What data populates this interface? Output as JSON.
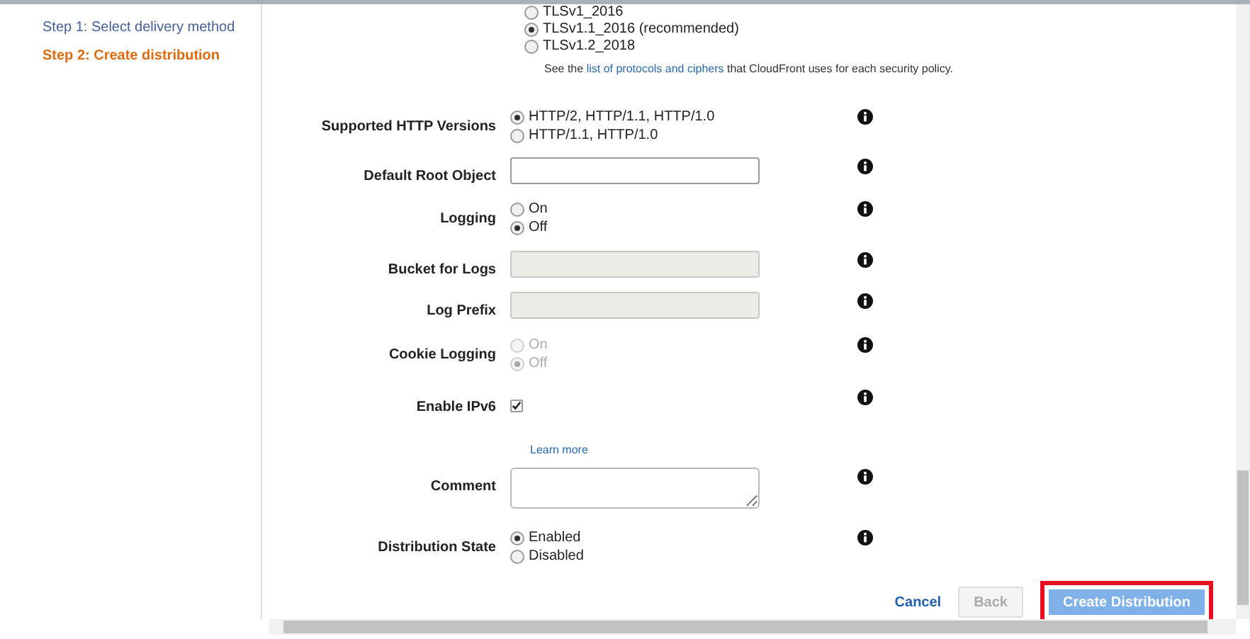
{
  "steps": [
    {
      "label": "Step 1: Select delivery method",
      "selected": false
    },
    {
      "label": "Step 2: Create distribution",
      "selected": true
    }
  ],
  "security_policy": {
    "options": [
      {
        "label": "TLSv1_2016",
        "selected": false
      },
      {
        "label": "TLSv1.1_2016 (recommended)",
        "selected": true
      },
      {
        "label": "TLSv1.2_2018",
        "selected": false
      }
    ],
    "note": {
      "before": "See the",
      "link": "list of protocols and ciphers",
      "after": "that CloudFront uses for each security policy."
    }
  },
  "fields": [
    {
      "kind": "radio",
      "label": "Supported HTTP Versions",
      "disabled": false,
      "options": [
        {
          "label": "HTTP/2, HTTP/1.1, HTTP/1.0",
          "selected": true
        },
        {
          "label": "HTTP/1.1, HTTP/1.0",
          "selected": false
        }
      ]
    },
    {
      "kind": "text",
      "label": "Default Root Object",
      "disabled": false
    },
    {
      "kind": "radio",
      "label": "Logging",
      "disabled": false,
      "options": [
        {
          "label": "On",
          "selected": false
        },
        {
          "label": "Off",
          "selected": true
        }
      ]
    },
    {
      "kind": "text",
      "label": "Bucket for Logs",
      "disabled": true
    },
    {
      "kind": "text",
      "label": "Log Prefix",
      "disabled": true
    },
    {
      "kind": "radio",
      "label": "Cookie Logging",
      "disabled": true,
      "options": [
        {
          "label": "On",
          "selected": false
        },
        {
          "label": "Off",
          "selected": true
        }
      ]
    },
    {
      "kind": "checkbox",
      "label": "Enable IPv6",
      "disabled": false,
      "checked": true,
      "link": "Learn more"
    },
    {
      "kind": "textarea",
      "label": "Comment",
      "disabled": false
    },
    {
      "kind": "radio",
      "label": "Distribution State",
      "disabled": false,
      "options": [
        {
          "label": "Enabled",
          "selected": true
        },
        {
          "label": "Disabled",
          "selected": false
        }
      ]
    }
  ],
  "buttons": [
    {
      "kind": "link",
      "label": "Cancel",
      "disabled": false,
      "highlighted": false
    },
    {
      "kind": "button",
      "label": "Back",
      "disabled": true,
      "highlighted": false
    },
    {
      "kind": "primary",
      "label": "Create Distribution",
      "disabled": false,
      "highlighted": true
    }
  ]
}
